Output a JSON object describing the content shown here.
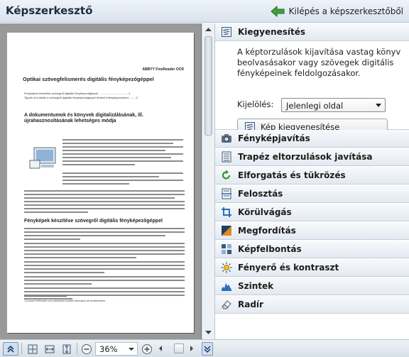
{
  "app": {
    "title": "Képszerkesztő",
    "exit_label": "Kilépés a képszerkesztőből"
  },
  "document": {
    "header": "ABBYY FineReader OCR",
    "title": "Optikai szövegfelismerés digitális fényképezőgéppel",
    "toc": [
      "Fényképek készítése szövegről digitális fényképezőgéppel ......................................1",
      "Tippek és trükkök a szövegről digitális fényképezőgéppel történő lefényképezéshez ........2"
    ],
    "h2_a": "A dokumentumok és könyvek digitalizálásának, ill. újrahasznosításának lehetséges módja",
    "h2_b": "Fényképek készítése szövegről digitális fényképezőgéppel",
    "footnote": "1 A www.FineReader.com webhelyen további információ áll rendelkezésre"
  },
  "panel": {
    "sections": [
      {
        "label": "Kiegyenesítés",
        "icon": "deskew-icon",
        "expanded": true
      },
      {
        "label": "Fényképjavítás",
        "icon": "camera-icon"
      },
      {
        "label": "Trapéz eltorzulások javítása",
        "icon": "trapezoid-icon"
      },
      {
        "label": "Elforgatás és tükrözés",
        "icon": "rotate-icon"
      },
      {
        "label": "Felosztás",
        "icon": "split-icon"
      },
      {
        "label": "Körülvágás",
        "icon": "crop-icon"
      },
      {
        "label": "Megfordítás",
        "icon": "invert-icon"
      },
      {
        "label": "Képfelbontás",
        "icon": "resolution-icon"
      },
      {
        "label": "Fényerő és kontraszt",
        "icon": "brightness-icon"
      },
      {
        "label": "Szintek",
        "icon": "levels-icon"
      },
      {
        "label": "Radír",
        "icon": "eraser-icon"
      }
    ],
    "deskew": {
      "description": "A képtorzulások kijavítása vastag könyv beolvasásakor vagy szövegek digitális fényképeinek feldolgozásakor.",
      "select_label": "Kijelölés:",
      "select_value": "Jelenlegi oldal",
      "button_label": "Kép kiegyenesítése"
    }
  },
  "bottom": {
    "zoom": "36%"
  },
  "colors": {
    "accent_green": "#2e9a2e",
    "preview_bg": "#999999",
    "panel_border": "#b9c6d4"
  }
}
